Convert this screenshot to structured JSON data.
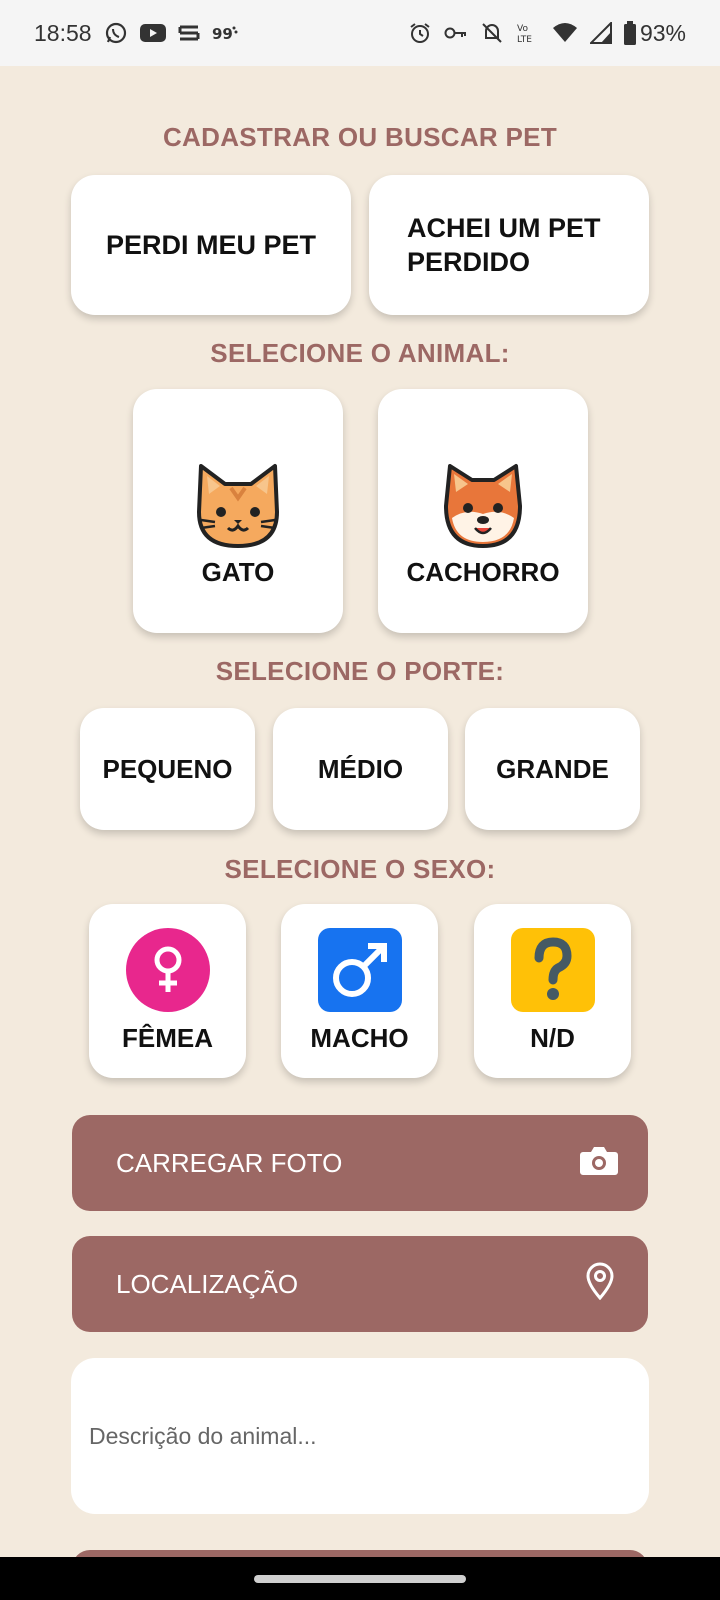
{
  "status_bar": {
    "time": "18:58",
    "battery": "93%",
    "left_icons": [
      "whatsapp-icon",
      "youtube-icon",
      "app-icon",
      "notification-icon"
    ],
    "right_icons": [
      "alarm-icon",
      "key-icon",
      "mute-icon",
      "volte-icon",
      "wifi-icon",
      "signal-icon",
      "battery-icon"
    ]
  },
  "header": {
    "title": "CADASTRAR OU BUSCAR PET"
  },
  "mode": {
    "lost_label": "PERDI MEU PET",
    "found_label": "ACHEI UM PET PERDIDO"
  },
  "animal": {
    "title": "SELECIONE O ANIMAL:",
    "options": [
      {
        "label": "GATO",
        "icon": "cat-icon"
      },
      {
        "label": "CACHORRO",
        "icon": "dog-icon"
      }
    ]
  },
  "size": {
    "title": "SELECIONE O PORTE:",
    "options": [
      "PEQUENO",
      "MÉDIO",
      "GRANDE"
    ]
  },
  "sex": {
    "title": "SELECIONE O SEXO:",
    "options": [
      {
        "label": "FÊMEA",
        "icon": "female-icon",
        "color": "#e8278d"
      },
      {
        "label": "MACHO",
        "icon": "male-icon",
        "color": "#1773f0"
      },
      {
        "label": "N/D",
        "icon": "question-icon",
        "color": "#ffc107"
      }
    ]
  },
  "actions": {
    "photo_label": "CARREGAR FOTO",
    "location_label": "LOCALIZAÇÃO"
  },
  "description": {
    "placeholder": "Descrição do animal..."
  },
  "colors": {
    "accent": "#9c6864",
    "background": "#f3eadd"
  }
}
